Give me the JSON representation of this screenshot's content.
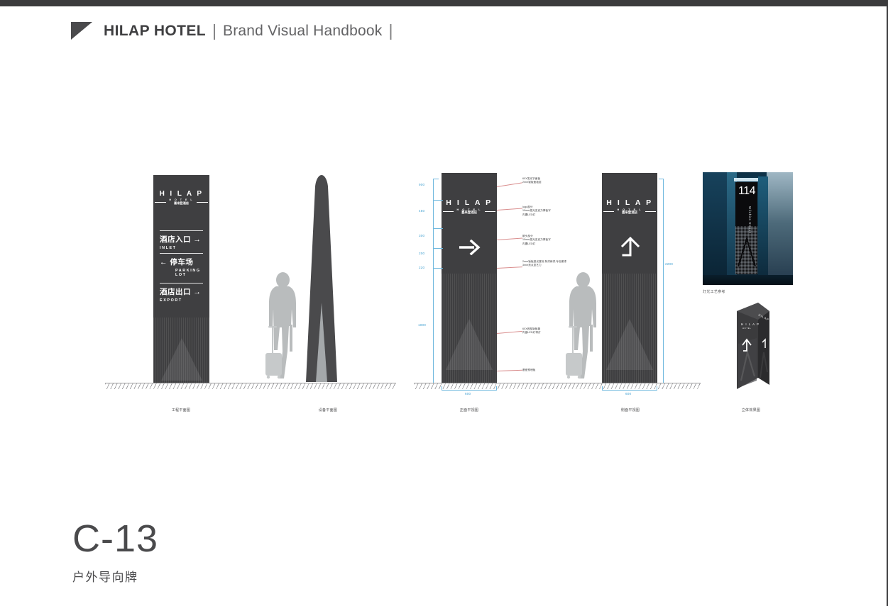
{
  "header": {
    "brand": "HILAP HOTEL",
    "separator": "|",
    "subtitle": "Brand Visual Handbook",
    "trailing": "|",
    "brandmark_icon": "flag-triangle-icon"
  },
  "colors": {
    "sign_body": "#3f3f41",
    "top_bar": "#3b3b3d",
    "dimension_blue": "#3f9fd0",
    "leader_pink": "#d98d8d",
    "person_gray": "#b9bcbd",
    "text_gray": "#4a4a4c"
  },
  "logo": {
    "wordmark": "H I L A P",
    "sub_en": "H O T E L",
    "sub_cn": "喜来登酒店"
  },
  "sign_directory": {
    "caption": "工程平面图",
    "rows": [
      {
        "cn": "酒店入口 →",
        "en": "INLET"
      },
      {
        "cn": "←   停车场",
        "en": "PARKING\nLOT"
      },
      {
        "cn": "酒店出口 →",
        "en": "EXPORT"
      }
    ]
  },
  "scale_view": {
    "caption": "设备平面图"
  },
  "front_elevation": {
    "caption": "正面平视图",
    "arrow_icon": "arrow-right-icon",
    "width_dim": "600",
    "height_dims": [
      "900",
      "450",
      "300",
      "200",
      "220",
      "1000"
    ],
    "notes": [
      "60X发光字面板\n2mm钣板面板层",
      "logo部分\n10mm激光亚克力厚板字\n内置LED灯",
      "箭头部分\n10mm激光亚克力厚板字\n内置LED灯",
      "2mm钣板激光镂刻,背漆烤漆,专色黑漆\n3mm亮点显艺力",
      "60X底部钣板箱\n内嵌LED灯带灯",
      "基座预埋板"
    ]
  },
  "side_elevation": {
    "caption": "侧面平视图",
    "arrow_icon": "arrow-up-turn-icon",
    "width_dim": "600",
    "height_dim": "2200"
  },
  "photo_reference": {
    "caption": "灯光工艺参考",
    "sign_number": "114",
    "sign_text": "Wilshire Street"
  },
  "render_view": {
    "caption": "立体效果图"
  },
  "page_label": {
    "number": "C-13",
    "title": "户外导向牌"
  }
}
